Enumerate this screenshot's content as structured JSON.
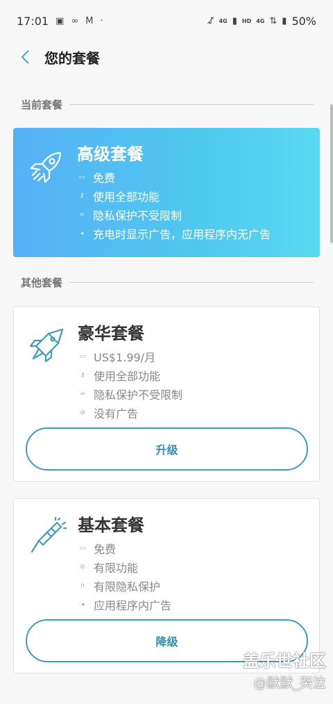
{
  "status_bar": {
    "time": "17:01",
    "left_icons": [
      "image-icon",
      "link-icon",
      "app-icon",
      "dot-icon"
    ],
    "signal_label": "4G",
    "hd_label": "HD",
    "battery": "50%"
  },
  "app_bar": {
    "title": "您的套餐",
    "back_icon": "chevron-left-icon"
  },
  "sections": {
    "current": "当前套餐",
    "other": "其他套餐"
  },
  "current_plan": {
    "name": "高级套餐",
    "icon": "rocket-icon",
    "features": [
      "免费",
      "使用全部功能",
      "隐私保护不受限制",
      "充电时显示广告，应用程序内无广告"
    ]
  },
  "other_plans": [
    {
      "name": "豪华套餐",
      "icon": "space-shuttle-icon",
      "features": [
        "US$1.99/月",
        "使用全部功能",
        "隐私保护不受限制",
        "没有广告"
      ],
      "button": "升级"
    },
    {
      "name": "基本套餐",
      "icon": "firework-rocket-icon",
      "features": [
        "免费",
        "有限功能",
        "有限隐私保护",
        "应用程序内广告"
      ],
      "button": "降级"
    }
  ],
  "watermark": {
    "line1": "盖乐世社区",
    "line2": "@默默_哭泣"
  },
  "colors": {
    "accent": "#3d9bbb",
    "gradient_start": "#57b0f6",
    "gradient_end": "#5ad8f0"
  }
}
